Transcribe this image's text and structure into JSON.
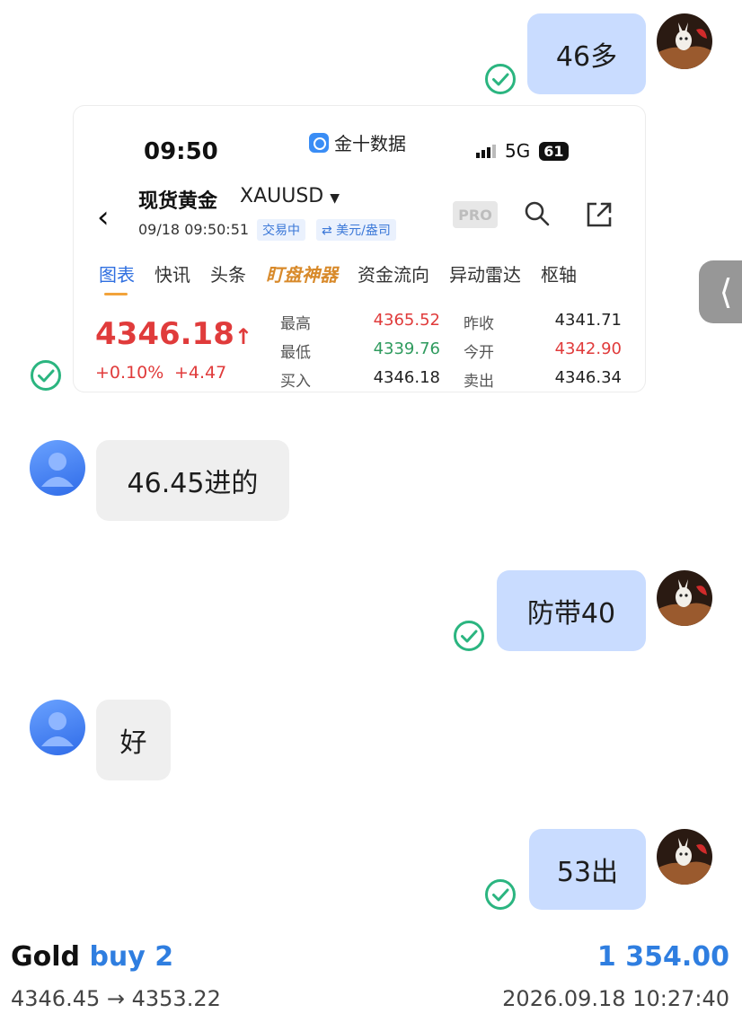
{
  "messages": {
    "m1": "46多",
    "m2": "46.45进的",
    "m3": "防带40",
    "m4": "好",
    "m5": "53出"
  },
  "screenshot": {
    "time": "09:50",
    "app_name": "金十数据",
    "network": "5G",
    "battery": "61",
    "title": "现货黄金",
    "symbol": "XAUUSD",
    "datetime": "09/18 09:50:51",
    "tag_trading": "交易中",
    "tag_currency": "⇄ 美元/盎司",
    "pro_label": "PRO",
    "tabs": [
      "图表",
      "快讯",
      "头条",
      "盯盘神器",
      "资金流向",
      "异动雷达",
      "枢轴"
    ],
    "price": "4346.18",
    "change_pct": "+0.10%",
    "change_abs": "+4.47",
    "quotes": {
      "high_label": "最高",
      "high": "4365.52",
      "prev_close_label": "昨收",
      "prev_close": "4341.71",
      "low_label": "最低",
      "low": "4339.76",
      "open_label": "今开",
      "open": "4342.90",
      "bid_label": "买入",
      "bid": "4346.18",
      "ask_label": "卖出",
      "ask": "4346.34"
    }
  },
  "footer": {
    "instrument": "Gold",
    "side": "buy 2",
    "amount": "1 354.00",
    "price_range": "4346.45 → 4353.22",
    "timestamp": "2026.09.18 10:27:40"
  },
  "colors": {
    "bubble_me": "#c9dcff",
    "bubble_them": "#efefef",
    "check": "#2bb580",
    "up_red": "#e03b3b",
    "down_green": "#2f9b5e",
    "accent_blue": "#2f7ee0"
  },
  "icons": [
    "check-circle-icon",
    "user-avatar-icon",
    "back-arrow-icon",
    "search-icon",
    "share-icon",
    "chevron-left-icon"
  ]
}
